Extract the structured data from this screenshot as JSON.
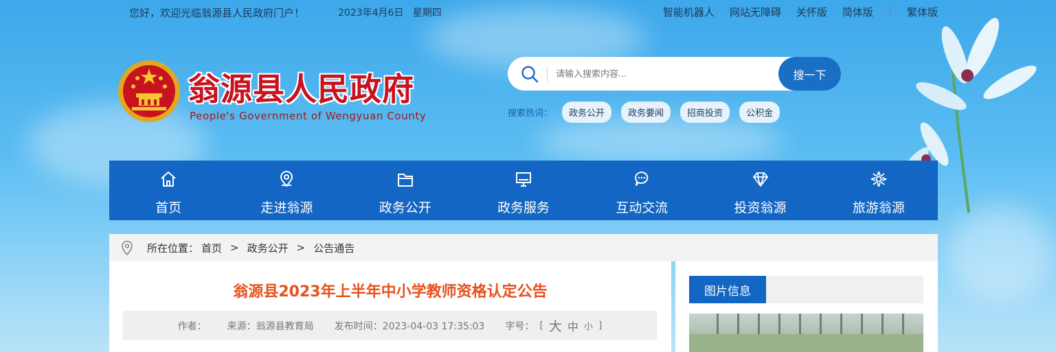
{
  "topbar": {
    "greeting": "您好，欢迎光临翁源县人民政府门户！",
    "date": "2023年4月6日   星期四",
    "links": [
      "智能机器人",
      "网站无障碍",
      "关怀版",
      "简体版",
      "繁体版"
    ]
  },
  "logo": {
    "title": "翁源县人民政府",
    "subtitle": "People's Government of Wengyuan County"
  },
  "search": {
    "placeholder": "请输入搜索内容...",
    "button": "搜一下",
    "hot_label": "搜索热词：",
    "hot_tags": [
      "政务公开",
      "政务要闻",
      "招商投资",
      "公积金"
    ]
  },
  "nav": {
    "items": [
      {
        "label": "首页",
        "icon": "home-icon"
      },
      {
        "label": "走进翁源",
        "icon": "location-pin-icon"
      },
      {
        "label": "政务公开",
        "icon": "folder-icon"
      },
      {
        "label": "政务服务",
        "icon": "monitor-icon"
      },
      {
        "label": "互动交流",
        "icon": "chat-bubble-icon"
      },
      {
        "label": "投资翁源",
        "icon": "diamond-icon"
      },
      {
        "label": "旅游翁源",
        "icon": "flower-icon"
      }
    ]
  },
  "breadcrumb": {
    "prefix": "所在位置：",
    "items": [
      "首页",
      "政务公开",
      "公告通告"
    ],
    "separator": ">"
  },
  "article": {
    "title": "翁源县2023年上半年中小学教师资格认定公告",
    "author_label": "作者：",
    "source": "来源：翁源县教育局",
    "publish_time": "发布时间：2023-04-03 17:35:03",
    "font_label": "字号：",
    "font_sizes": [
      "大",
      "中",
      "小"
    ],
    "bracket_open": "[",
    "bracket_close": "]"
  },
  "sidebar": {
    "tab": "图片信息"
  },
  "colors": {
    "nav_blue": "#1366c3",
    "title_red": "#c8121e",
    "article_title_orange": "#e6511e"
  }
}
